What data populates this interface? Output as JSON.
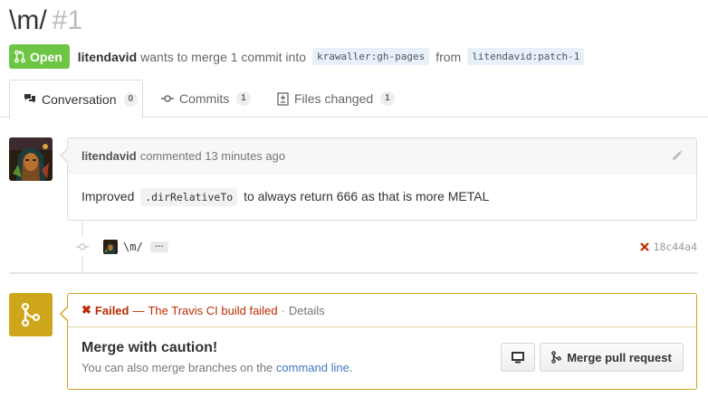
{
  "pull_request": {
    "title": "\\m/",
    "number": "#1",
    "state": "Open",
    "author": "litendavid",
    "merge_text": "wants to merge 1 commit into",
    "base_ref": "krawaller:gh-pages",
    "from_text": "from",
    "head_ref": "litendavid:patch-1"
  },
  "tabs": [
    {
      "label": "Conversation",
      "count": "0",
      "icon": "comment-discussion-icon"
    },
    {
      "label": "Commits",
      "count": "1",
      "icon": "git-commit-icon"
    },
    {
      "label": "Files changed",
      "count": "1",
      "icon": "diff-icon"
    }
  ],
  "comment": {
    "author": "litendavid",
    "action": "commented 13 minutes ago",
    "body_before": "Improved",
    "body_code": ".dirRelativeTo",
    "body_after": "to always return 666 as that is more METAL"
  },
  "commit": {
    "message": "\\m/",
    "ellipsis": "…",
    "sha": "18c44a4",
    "status": "failed"
  },
  "merge": {
    "status_label": "Failed",
    "status_dash": "—",
    "status_description": "The Travis CI build failed",
    "status_sep": "·",
    "details_label": "Details",
    "title": "Merge with caution!",
    "subtitle_before": "You can also merge branches on the",
    "subtitle_link": "command line",
    "subtitle_after": ".",
    "merge_button_label": "Merge pull request"
  },
  "colors": {
    "open_green": "#6cc644",
    "fail_red": "#bd2c00",
    "warning_yellow": "#cea61b",
    "link_blue": "#4078c0"
  }
}
